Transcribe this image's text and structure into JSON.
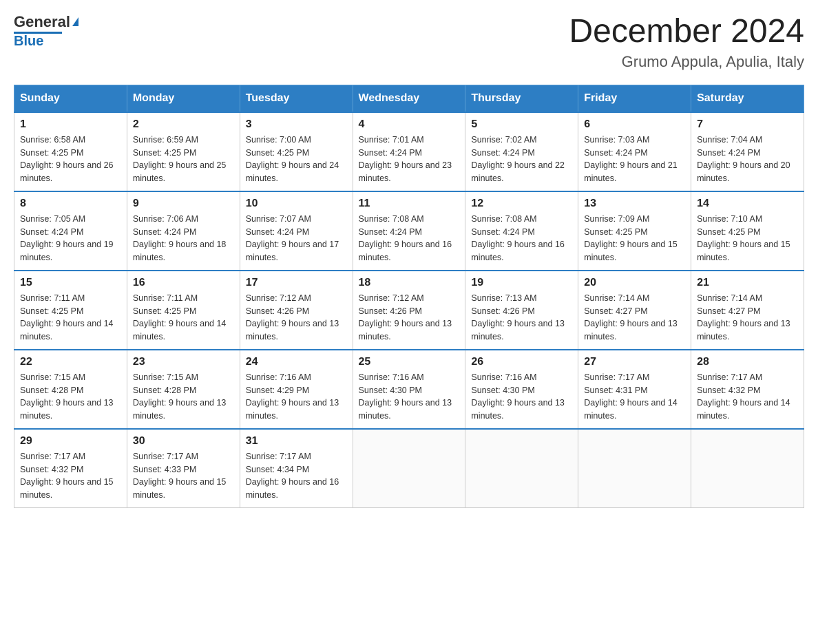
{
  "header": {
    "logo": {
      "text_general": "General",
      "text_blue": "Blue"
    },
    "title": "December 2024",
    "subtitle": "Grumo Appula, Apulia, Italy"
  },
  "calendar": {
    "days_of_week": [
      "Sunday",
      "Monday",
      "Tuesday",
      "Wednesday",
      "Thursday",
      "Friday",
      "Saturday"
    ],
    "weeks": [
      [
        {
          "day": "1",
          "sunrise": "Sunrise: 6:58 AM",
          "sunset": "Sunset: 4:25 PM",
          "daylight": "Daylight: 9 hours and 26 minutes."
        },
        {
          "day": "2",
          "sunrise": "Sunrise: 6:59 AM",
          "sunset": "Sunset: 4:25 PM",
          "daylight": "Daylight: 9 hours and 25 minutes."
        },
        {
          "day": "3",
          "sunrise": "Sunrise: 7:00 AM",
          "sunset": "Sunset: 4:25 PM",
          "daylight": "Daylight: 9 hours and 24 minutes."
        },
        {
          "day": "4",
          "sunrise": "Sunrise: 7:01 AM",
          "sunset": "Sunset: 4:24 PM",
          "daylight": "Daylight: 9 hours and 23 minutes."
        },
        {
          "day": "5",
          "sunrise": "Sunrise: 7:02 AM",
          "sunset": "Sunset: 4:24 PM",
          "daylight": "Daylight: 9 hours and 22 minutes."
        },
        {
          "day": "6",
          "sunrise": "Sunrise: 7:03 AM",
          "sunset": "Sunset: 4:24 PM",
          "daylight": "Daylight: 9 hours and 21 minutes."
        },
        {
          "day": "7",
          "sunrise": "Sunrise: 7:04 AM",
          "sunset": "Sunset: 4:24 PM",
          "daylight": "Daylight: 9 hours and 20 minutes."
        }
      ],
      [
        {
          "day": "8",
          "sunrise": "Sunrise: 7:05 AM",
          "sunset": "Sunset: 4:24 PM",
          "daylight": "Daylight: 9 hours and 19 minutes."
        },
        {
          "day": "9",
          "sunrise": "Sunrise: 7:06 AM",
          "sunset": "Sunset: 4:24 PM",
          "daylight": "Daylight: 9 hours and 18 minutes."
        },
        {
          "day": "10",
          "sunrise": "Sunrise: 7:07 AM",
          "sunset": "Sunset: 4:24 PM",
          "daylight": "Daylight: 9 hours and 17 minutes."
        },
        {
          "day": "11",
          "sunrise": "Sunrise: 7:08 AM",
          "sunset": "Sunset: 4:24 PM",
          "daylight": "Daylight: 9 hours and 16 minutes."
        },
        {
          "day": "12",
          "sunrise": "Sunrise: 7:08 AM",
          "sunset": "Sunset: 4:24 PM",
          "daylight": "Daylight: 9 hours and 16 minutes."
        },
        {
          "day": "13",
          "sunrise": "Sunrise: 7:09 AM",
          "sunset": "Sunset: 4:25 PM",
          "daylight": "Daylight: 9 hours and 15 minutes."
        },
        {
          "day": "14",
          "sunrise": "Sunrise: 7:10 AM",
          "sunset": "Sunset: 4:25 PM",
          "daylight": "Daylight: 9 hours and 15 minutes."
        }
      ],
      [
        {
          "day": "15",
          "sunrise": "Sunrise: 7:11 AM",
          "sunset": "Sunset: 4:25 PM",
          "daylight": "Daylight: 9 hours and 14 minutes."
        },
        {
          "day": "16",
          "sunrise": "Sunrise: 7:11 AM",
          "sunset": "Sunset: 4:25 PM",
          "daylight": "Daylight: 9 hours and 14 minutes."
        },
        {
          "day": "17",
          "sunrise": "Sunrise: 7:12 AM",
          "sunset": "Sunset: 4:26 PM",
          "daylight": "Daylight: 9 hours and 13 minutes."
        },
        {
          "day": "18",
          "sunrise": "Sunrise: 7:12 AM",
          "sunset": "Sunset: 4:26 PM",
          "daylight": "Daylight: 9 hours and 13 minutes."
        },
        {
          "day": "19",
          "sunrise": "Sunrise: 7:13 AM",
          "sunset": "Sunset: 4:26 PM",
          "daylight": "Daylight: 9 hours and 13 minutes."
        },
        {
          "day": "20",
          "sunrise": "Sunrise: 7:14 AM",
          "sunset": "Sunset: 4:27 PM",
          "daylight": "Daylight: 9 hours and 13 minutes."
        },
        {
          "day": "21",
          "sunrise": "Sunrise: 7:14 AM",
          "sunset": "Sunset: 4:27 PM",
          "daylight": "Daylight: 9 hours and 13 minutes."
        }
      ],
      [
        {
          "day": "22",
          "sunrise": "Sunrise: 7:15 AM",
          "sunset": "Sunset: 4:28 PM",
          "daylight": "Daylight: 9 hours and 13 minutes."
        },
        {
          "day": "23",
          "sunrise": "Sunrise: 7:15 AM",
          "sunset": "Sunset: 4:28 PM",
          "daylight": "Daylight: 9 hours and 13 minutes."
        },
        {
          "day": "24",
          "sunrise": "Sunrise: 7:16 AM",
          "sunset": "Sunset: 4:29 PM",
          "daylight": "Daylight: 9 hours and 13 minutes."
        },
        {
          "day": "25",
          "sunrise": "Sunrise: 7:16 AM",
          "sunset": "Sunset: 4:30 PM",
          "daylight": "Daylight: 9 hours and 13 minutes."
        },
        {
          "day": "26",
          "sunrise": "Sunrise: 7:16 AM",
          "sunset": "Sunset: 4:30 PM",
          "daylight": "Daylight: 9 hours and 13 minutes."
        },
        {
          "day": "27",
          "sunrise": "Sunrise: 7:17 AM",
          "sunset": "Sunset: 4:31 PM",
          "daylight": "Daylight: 9 hours and 14 minutes."
        },
        {
          "day": "28",
          "sunrise": "Sunrise: 7:17 AM",
          "sunset": "Sunset: 4:32 PM",
          "daylight": "Daylight: 9 hours and 14 minutes."
        }
      ],
      [
        {
          "day": "29",
          "sunrise": "Sunrise: 7:17 AM",
          "sunset": "Sunset: 4:32 PM",
          "daylight": "Daylight: 9 hours and 15 minutes."
        },
        {
          "day": "30",
          "sunrise": "Sunrise: 7:17 AM",
          "sunset": "Sunset: 4:33 PM",
          "daylight": "Daylight: 9 hours and 15 minutes."
        },
        {
          "day": "31",
          "sunrise": "Sunrise: 7:17 AM",
          "sunset": "Sunset: 4:34 PM",
          "daylight": "Daylight: 9 hours and 16 minutes."
        },
        null,
        null,
        null,
        null
      ]
    ]
  }
}
